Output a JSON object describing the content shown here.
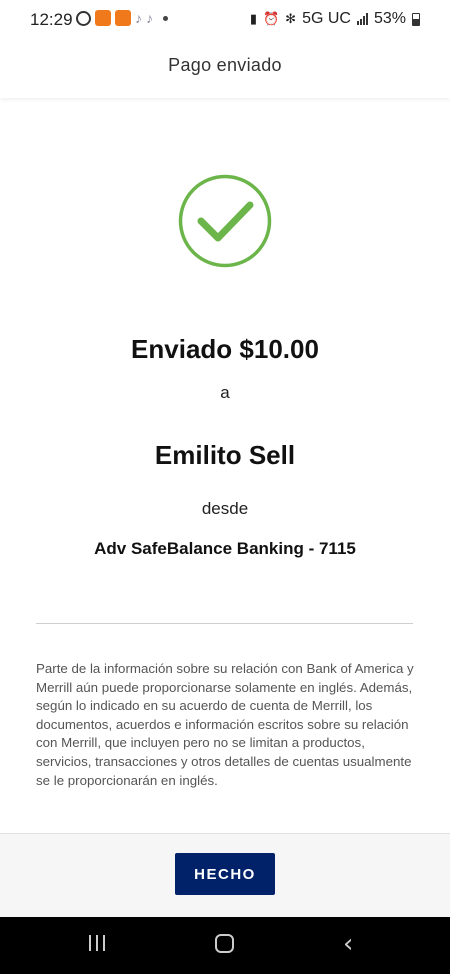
{
  "status_bar": {
    "time": "12:29",
    "network": "5G UC",
    "battery": "53%"
  },
  "header": {
    "title": "Pago enviado"
  },
  "confirmation": {
    "sent_amount": "Enviado $10.00",
    "to_word": "a",
    "recipient": "Emilito Sell",
    "from_word": "desde",
    "account": "Adv SafeBalance Banking - 7115",
    "check_color": "#6bb54a"
  },
  "disclaimer": {
    "text": "Parte de la información sobre su relación con Bank of America y Merrill aún puede proporcionarse solamente en inglés. Además, según lo indicado en su acuerdo de cuenta de Merrill, los documentos, acuerdos e información escritos sobre su relación con Merrill, que incluyen pero no se limitan a productos, servicios, transacciones y otros detalles de cuentas usualmente se le proporcionarán en inglés."
  },
  "footer": {
    "done_label": "HECHO",
    "button_color": "#012169"
  },
  "icons": {
    "success": "check-circle-icon",
    "nav_recent": "recent-apps-icon",
    "nav_home": "home-icon",
    "nav_back": "back-icon"
  }
}
